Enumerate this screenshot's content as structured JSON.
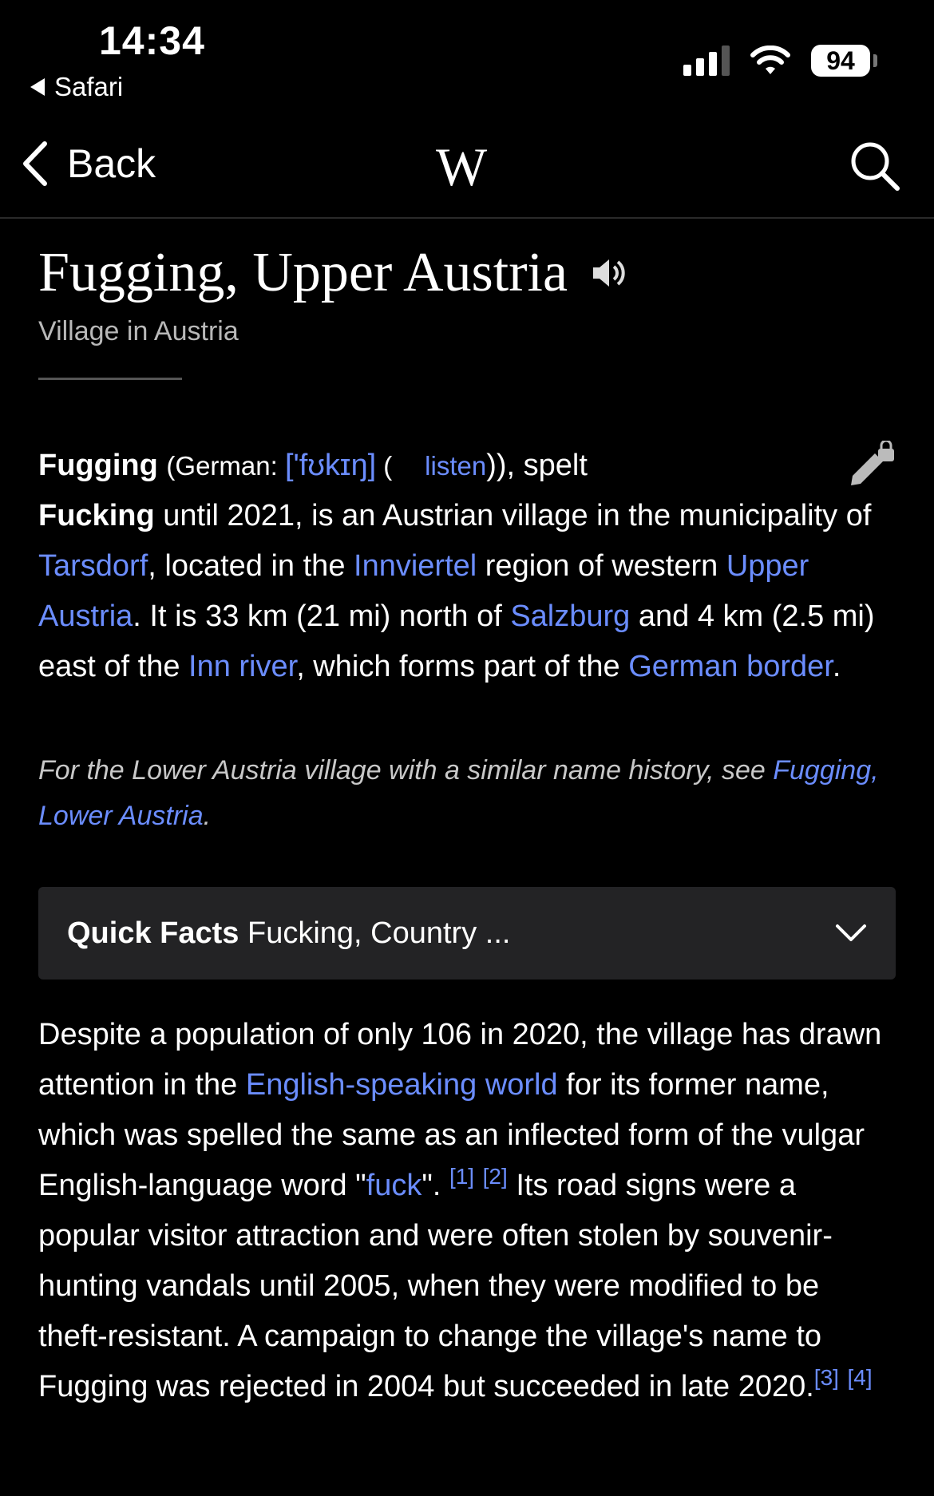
{
  "status": {
    "time": "14:34",
    "back_app": "Safari",
    "battery": "94"
  },
  "nav": {
    "back_label": "Back",
    "logo": "W"
  },
  "article": {
    "title": "Fugging, Upper Austria",
    "subtitle": "Village in Austria",
    "intro": {
      "name": "Fugging",
      "german_prefix": "(German: ",
      "ipa": "['fʊkɪŋ]",
      "listen_open": " ( ",
      "listen": "listen",
      "listen_close": ")), spelt",
      "former": "Fucking",
      "t1": " until 2021, is an Austrian village in the municipality of ",
      "tarsdorf": "Tarsdorf",
      "t2": ", located in the ",
      "innviertel": "Innviertel",
      "t3": " region of western ",
      "upper_austria": "Upper Austria",
      "t4": ". It is 33 km (21 mi) north of ",
      "salzburg": "Salzburg",
      "t5": " and 4 km (2.5 mi) east of the ",
      "inn_river": "Inn river",
      "t6": ", which forms part of the ",
      "german_border": "German border",
      "t7": "."
    },
    "note": {
      "text": "For the Lower Austria village with a similar name history, see ",
      "link": "Fugging, Lower Austria",
      "end": "."
    },
    "quick_facts": {
      "label": "Quick Facts",
      "summary": "Fucking, Country ..."
    },
    "body": {
      "t1": "Despite a population of only 106 in 2020, the village has drawn attention in the ",
      "esw": "English-speaking world",
      "t2": " for its former name, which was spelled the same as an inflected form of the vulgar English-language word \"",
      "fuck": "fuck",
      "t3": "\". ",
      "ref1": "[1]",
      "ref2": "[2]",
      "t4": " Its road signs were a popular visitor attraction and were often stolen by souvenir-hunting vandals until 2005, when they were modified to be theft-resistant. A campaign to change the village's name to Fugging was rejected in 2004 but succeeded in late 2020.",
      "ref3": "[3]",
      "ref4": "[4]"
    }
  },
  "colors": {
    "background": "#000000",
    "link": "#6b8dff",
    "panel": "#232325"
  }
}
